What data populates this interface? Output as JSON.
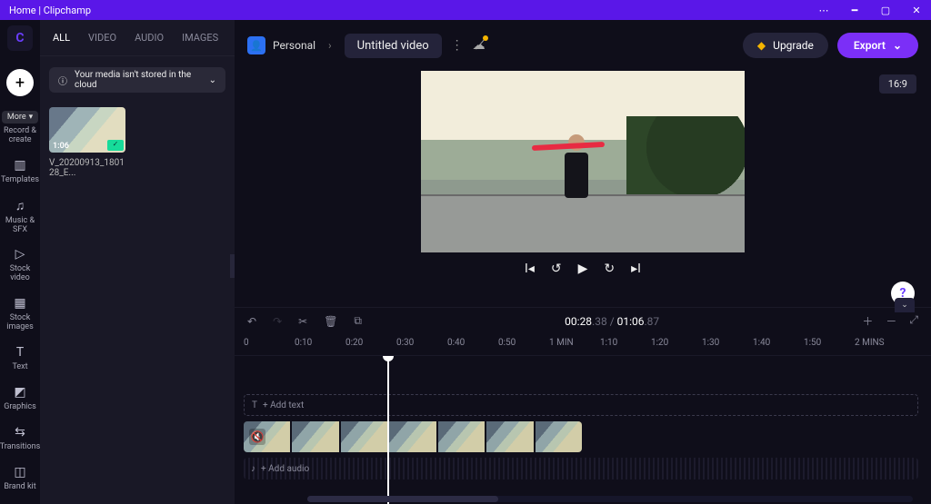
{
  "titlebar": {
    "title": "Home | Clipchamp"
  },
  "rail": {
    "more": "More",
    "record_create": "Record & create",
    "templates": "Templates",
    "music_sfx": "Music & SFX",
    "stock_video": "Stock video",
    "stock_images": "Stock images",
    "text": "Text",
    "graphics": "Graphics",
    "transitions": "Transitions",
    "brand_kit": "Brand kit"
  },
  "media": {
    "tabs": {
      "all": "ALL",
      "video": "VIDEO",
      "audio": "AUDIO",
      "images": "IMAGES"
    },
    "cloud_notice": "Your media isn't stored in the cloud",
    "clip": {
      "duration": "1:06",
      "filename": "V_20200913_180128_E..."
    }
  },
  "top": {
    "space": "Personal",
    "project_name": "Untitled video",
    "upgrade": "Upgrade",
    "export": "Export",
    "aspect": "16:9"
  },
  "playback": {
    "current": "00:28",
    "current_frac": ".38",
    "sep": " / ",
    "total": "01:06",
    "total_frac": ".87"
  },
  "ruler": [
    "0",
    "0:10",
    "0:20",
    "0:30",
    "0:40",
    "0:50",
    "1 MIN",
    "1:10",
    "1:20",
    "1:30",
    "1:40",
    "1:50",
    "2 MINS"
  ],
  "tracks": {
    "add_text": "+ Add text",
    "add_audio": "+ Add audio"
  }
}
